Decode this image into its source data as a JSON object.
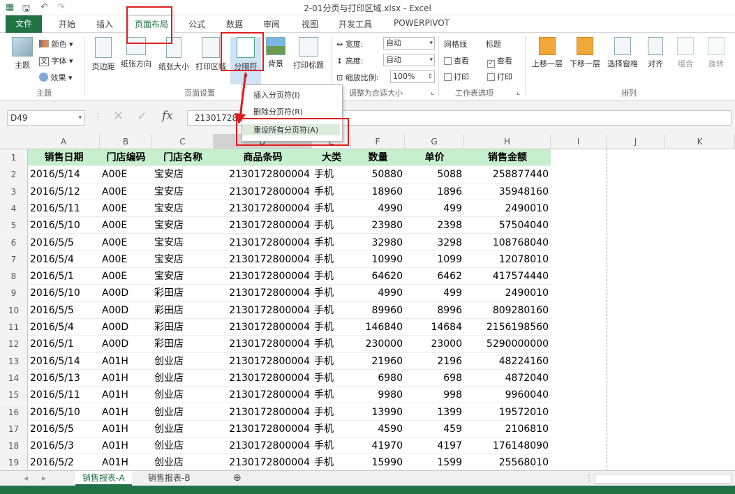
{
  "window": {
    "title": "2-01分页与打印区域.xlsx - Excel"
  },
  "tabs": {
    "file": "文件",
    "home": "开始",
    "insert": "插入",
    "layout": "页面布局",
    "formulas": "公式",
    "data": "数据",
    "review": "审阅",
    "view": "视图",
    "developer": "开发工具",
    "powerpivot": "POWERPIVOT"
  },
  "ribbon": {
    "theme": {
      "themes": "主题",
      "colors": "颜色",
      "fonts": "字体",
      "effects": "效果",
      "group": "主题"
    },
    "page_setup": {
      "margins": "页边距",
      "orientation": "纸张方向",
      "size": "纸张大小",
      "print_area": "打印区域",
      "breaks": "分隔符",
      "background": "背景",
      "print_titles": "打印标题",
      "group": "页面设置"
    },
    "scale": {
      "width_label": "宽度:",
      "width_value": "自动",
      "height_label": "高度:",
      "height_value": "自动",
      "scale_label": "缩放比例:",
      "scale_value": "100%",
      "group": "调整为合适大小"
    },
    "sheet_options": {
      "gridlines": "网格线",
      "headings": "标题",
      "view": "查看",
      "print": "打印",
      "group": "工作表选项",
      "gridlines_view_checked": false,
      "headings_view_checked": true
    },
    "arrange": {
      "bring_forward": "上移一层",
      "send_backward": "下移一层",
      "selection_pane": "选择窗格",
      "align": "对齐",
      "group_btn": "组合",
      "rotate": "旋转",
      "group": "排列"
    }
  },
  "dropdown": {
    "items": [
      "插入分页符(I)",
      "删除分页符(R)",
      "重设所有分页符(A)"
    ]
  },
  "formula_bar": {
    "name_box": "D49",
    "formula": "2130172800004"
  },
  "columns": [
    "A",
    "B",
    "C",
    "D",
    "E",
    "F",
    "G",
    "H",
    "I",
    "J",
    "K"
  ],
  "headers": [
    "销售日期",
    "门店编码",
    "门店名称",
    "商品条码",
    "大类",
    "数量",
    "单价",
    "销售金额"
  ],
  "rows": [
    [
      "2016/5/14",
      "A00E",
      "宝安店",
      "2130172800004",
      "手机",
      "50880",
      "5088",
      "258877440"
    ],
    [
      "2016/5/12",
      "A00E",
      "宝安店",
      "2130172800004",
      "手机",
      "18960",
      "1896",
      "35948160"
    ],
    [
      "2016/5/11",
      "A00E",
      "宝安店",
      "2130172800004",
      "手机",
      "4990",
      "499",
      "2490010"
    ],
    [
      "2016/5/10",
      "A00E",
      "宝安店",
      "2130172800004",
      "手机",
      "23980",
      "2398",
      "57504040"
    ],
    [
      "2016/5/5",
      "A00E",
      "宝安店",
      "2130172800004",
      "手机",
      "32980",
      "3298",
      "108768040"
    ],
    [
      "2016/5/4",
      "A00E",
      "宝安店",
      "2130172800004",
      "手机",
      "10990",
      "1099",
      "12078010"
    ],
    [
      "2016/5/1",
      "A00E",
      "宝安店",
      "2130172800004",
      "手机",
      "64620",
      "6462",
      "417574440"
    ],
    [
      "2016/5/10",
      "A00D",
      "彩田店",
      "2130172800004",
      "手机",
      "4990",
      "499",
      "2490010"
    ],
    [
      "2016/5/5",
      "A00D",
      "彩田店",
      "2130172800004",
      "手机",
      "89960",
      "8996",
      "809280160"
    ],
    [
      "2016/5/4",
      "A00D",
      "彩田店",
      "2130172800004",
      "手机",
      "146840",
      "14684",
      "2156198560"
    ],
    [
      "2016/5/1",
      "A00D",
      "彩田店",
      "2130172800004",
      "手机",
      "230000",
      "23000",
      "5290000000"
    ],
    [
      "2016/5/14",
      "A01H",
      "创业店",
      "2130172800004",
      "手机",
      "21960",
      "2196",
      "48224160"
    ],
    [
      "2016/5/13",
      "A01H",
      "创业店",
      "2130172800004",
      "手机",
      "6980",
      "698",
      "4872040"
    ],
    [
      "2016/5/11",
      "A01H",
      "创业店",
      "2130172800004",
      "手机",
      "9980",
      "998",
      "9960040"
    ],
    [
      "2016/5/10",
      "A01H",
      "创业店",
      "2130172800004",
      "手机",
      "13990",
      "1399",
      "19572010"
    ],
    [
      "2016/5/5",
      "A01H",
      "创业店",
      "2130172800004",
      "手机",
      "4590",
      "459",
      "2106810"
    ],
    [
      "2016/5/3",
      "A01H",
      "创业店",
      "2130172800004",
      "手机",
      "41970",
      "4197",
      "176148090"
    ],
    [
      "2016/5/2",
      "A01H",
      "创业店",
      "2130172800004",
      "手机",
      "15990",
      "1599",
      "25568010"
    ]
  ],
  "sheets": [
    "销售报表-A",
    "销售报表-B"
  ],
  "colors": {
    "accent": "#217346",
    "header_fill": "#c6efce",
    "highlight": "#e01d1d"
  }
}
